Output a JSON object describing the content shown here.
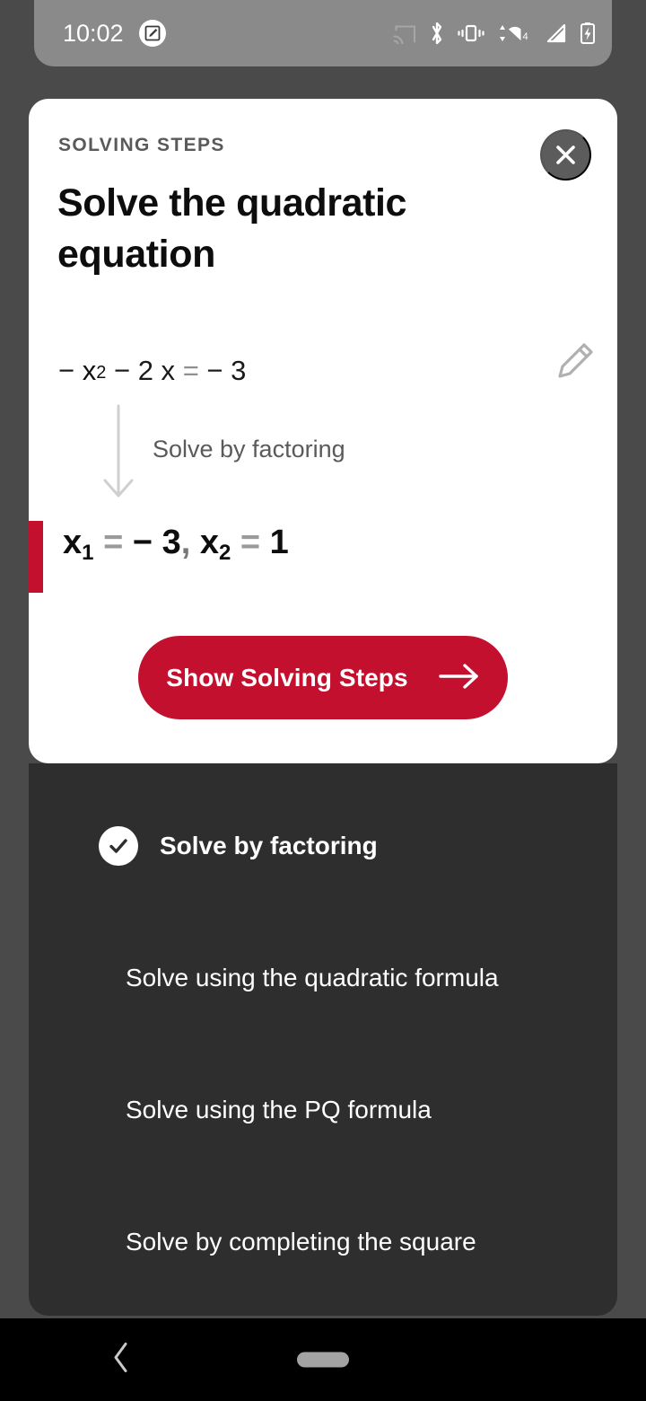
{
  "status_bar": {
    "time": "10:02",
    "icons": [
      "screenshot-edit-icon",
      "cast-icon",
      "bluetooth-icon",
      "vibrate-icon",
      "wifi-icon",
      "signal-icon",
      "battery-charging-icon"
    ],
    "wifi_label": "4"
  },
  "card": {
    "kicker": "SOLVING STEPS",
    "title": "Solve the quadratic equation",
    "close_label": "×",
    "equation": {
      "lhs_sign": "−",
      "variable": "x",
      "exponent": "2",
      "term2": "− 2 x",
      "equals": "=",
      "rhs": "− 3",
      "plain": "− x² − 2 x = − 3"
    },
    "edit_icon": "pencil-icon",
    "arrow_icon": "down-arrow-icon",
    "step_label": "Solve by factoring",
    "solution": {
      "var1": "x",
      "sub1": "1",
      "equals1": "=",
      "value1": "− 3",
      "separator": ",",
      "var2": "x",
      "sub2": "2",
      "equals2": "=",
      "value2": "1",
      "plain": "x₁ = − 3 , x₂ = 1"
    },
    "cta_label": "Show Solving Steps",
    "cta_icon": "right-arrow-icon"
  },
  "methods": {
    "items": [
      {
        "label": "Solve by factoring",
        "selected": true,
        "icon": "check-circle-icon"
      },
      {
        "label": "Solve using the quadratic formula",
        "selected": false
      },
      {
        "label": "Solve using the PQ formula",
        "selected": false
      },
      {
        "label": "Solve by completing the square",
        "selected": false
      }
    ]
  },
  "nav_bar": {
    "back_icon": "chevron-left-icon",
    "home_pill": "home-pill"
  },
  "colors": {
    "accent_red": "#c4102f",
    "card_bg": "#ffffff",
    "list_bg": "#2e2e2e",
    "scrim": "#4a4a4a",
    "status_bar_bg": "#8a8a8a",
    "chip_brown": "#9e4a1e"
  }
}
